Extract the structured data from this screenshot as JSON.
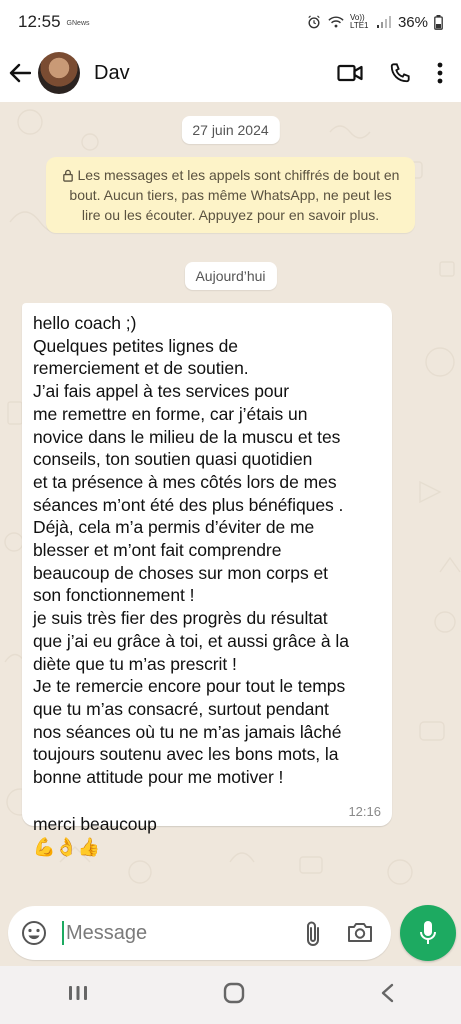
{
  "status_bar": {
    "time": "12:55",
    "small_label": "GNews",
    "network": "Vo)) LTE1",
    "battery": "36%"
  },
  "header": {
    "contact_name": "Dav",
    "icons": [
      "back-arrow-icon",
      "video-call-icon",
      "phone-icon",
      "more-vert-icon"
    ]
  },
  "chat": {
    "date_chip_1": "27 juin 2024",
    "encryption_notice": "Les messages et les appels sont chiffrés de bout en bout. Aucun tiers, pas même WhatsApp, ne peut les lire ou les écouter. Appuyez pour en savoir plus.",
    "date_chip_2": "Aujourd’hui",
    "message": {
      "text": "hello coach ;)\nQuelques petites lignes de\nremerciement et de soutien.\nJ’ai fais appel à tes services pour\nme remettre en forme,  car j’étais un\nnovice dans le milieu de la muscu et tes\nconseils,  ton soutien quasi quotidien\net ta présence à mes côtés lors de mes\nséances m’ont été des plus bénéfiques .\nDéjà, cela m’a permis d’éviter de me\nblesser et m’ont fait comprendre\nbeaucoup de choses sur mon corps et\nson fonctionnement !\nje suis très fier des progrès du résultat\nque j’ai eu grâce à toi, et aussi grâce à la\ndiète que tu m’as prescrit  !\nJe te remercie encore pour tout le temps\nque tu m’as consacré, surtout pendant\nnos séances où tu ne m’as jamais lâché\ntoujours soutenu avec les bons mots, la\nbonne attitude pour me motiver !",
      "last_line": "merci beaucoup",
      "emojis": "💪👌👍",
      "time": "12:16"
    }
  },
  "composer": {
    "placeholder": "Message"
  },
  "colors": {
    "accent_green": "#1daa61",
    "chat_bg": "#efe7dc",
    "notice_bg": "#fdf3c8"
  }
}
